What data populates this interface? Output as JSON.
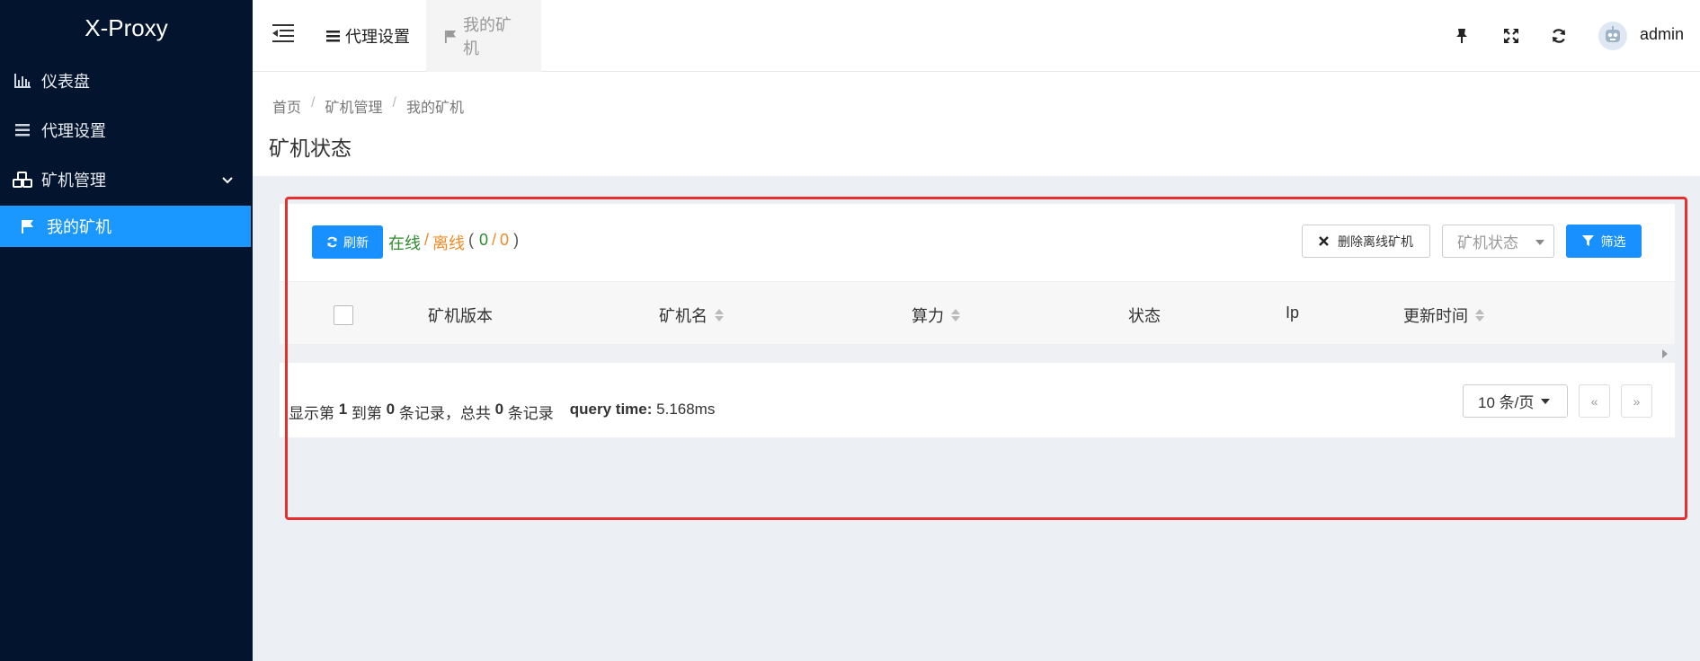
{
  "app": {
    "title": "X-Proxy"
  },
  "sidebar": {
    "items": [
      {
        "label": "仪表盘",
        "icon": "bar-chart-icon"
      },
      {
        "label": "代理设置",
        "icon": "list-icon"
      },
      {
        "label": "矿机管理",
        "icon": "cubes-icon"
      },
      {
        "label": "我的矿机",
        "icon": "flag-icon"
      }
    ]
  },
  "header": {
    "tabs": [
      {
        "label": "代理设置",
        "icon": "list-icon"
      },
      {
        "label": "我的矿机",
        "icon": "flag-icon"
      }
    ],
    "user": "admin"
  },
  "breadcrumb": [
    "首页",
    "矿机管理",
    "我的矿机"
  ],
  "page_title": "矿机状态",
  "toolbar": {
    "refresh": "刷新",
    "online_label": "在线",
    "slash": "/",
    "offline_label": "离线",
    "paren_open": "(",
    "online_count": "0",
    "offline_count": "0",
    "paren_close": ")",
    "delete_offline": "删除离线矿机",
    "status_select": "矿机状态",
    "filter": "筛选"
  },
  "table": {
    "columns": [
      "矿机版本",
      "矿机名",
      "算力",
      "状态",
      "Ip",
      "更新时间"
    ]
  },
  "pagination": {
    "info_prefix": "显示第 ",
    "from": "1",
    "info_mid1": " 到第 ",
    "to": "0",
    "info_mid2": " 条记录，总共 ",
    "total": "0",
    "info_suffix": " 条记录",
    "query_label": "query time:",
    "query_value": " 5.168ms",
    "page_size": "10 条/页",
    "prev": "«",
    "next": "»"
  },
  "colors": {
    "sidebar_bg": "#03152e",
    "accent": "#1890ff",
    "online": "#2e8b2e",
    "offline": "#f08a24",
    "highlight": "#e63030"
  }
}
